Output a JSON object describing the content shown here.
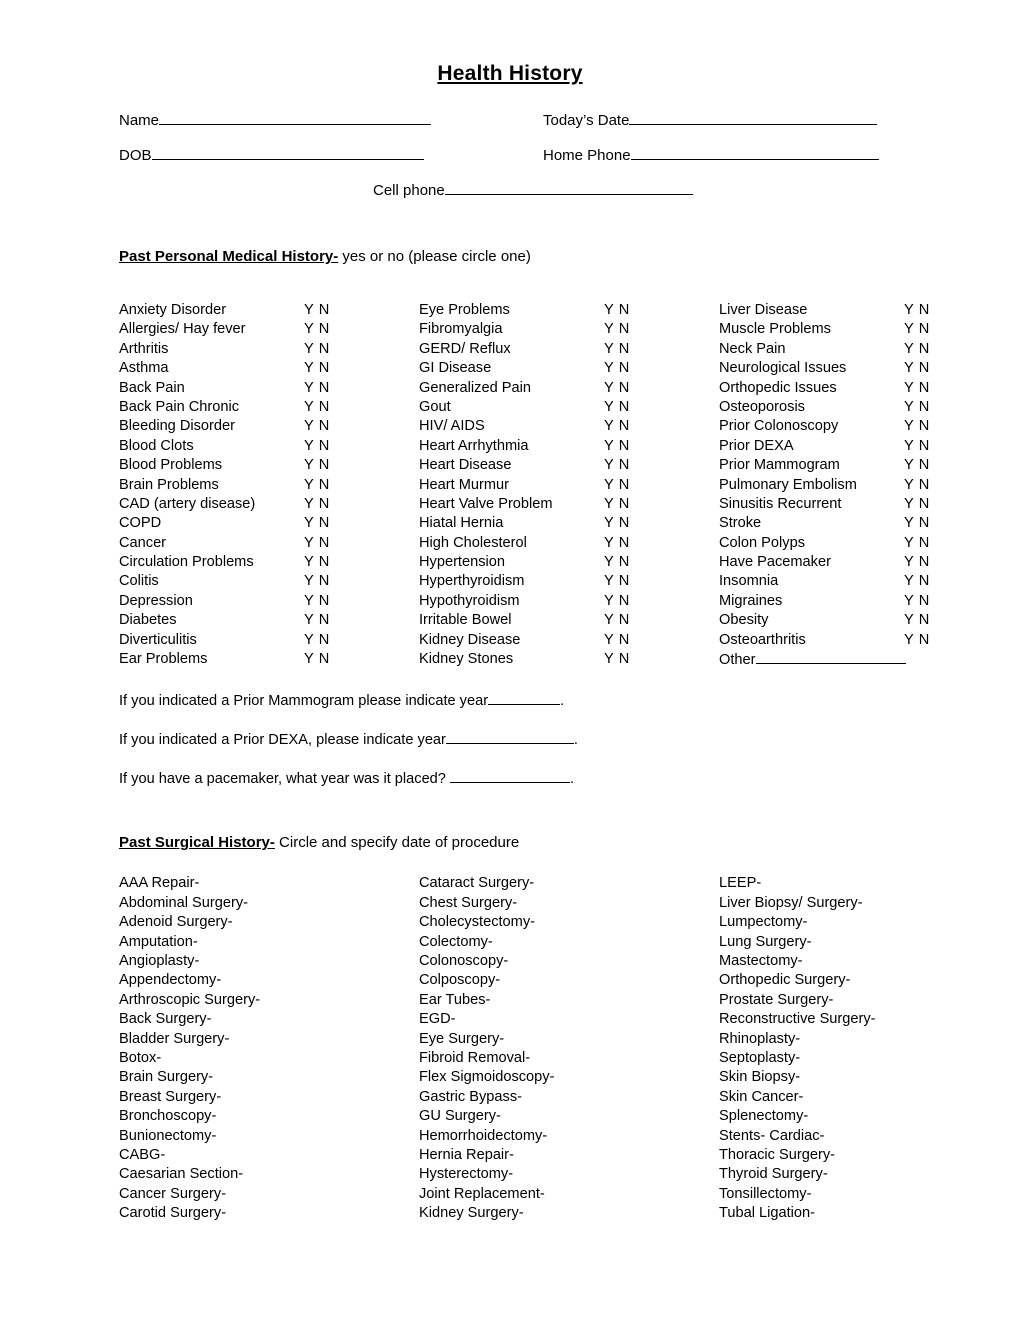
{
  "document": {
    "title": "Health History"
  },
  "patient_fields": {
    "name_label": "Name",
    "dob_label": "DOB",
    "todays_date_label": "Today’s Date",
    "home_phone_label": "Home Phone",
    "cell_phone_label": "Cell phone",
    "name_value": "",
    "dob_value": "",
    "todays_date_value": "",
    "home_phone_value": "",
    "cell_phone_value": ""
  },
  "medical_history": {
    "heading_strong": "Past Personal Medical History-",
    "heading_rest": " yes or no (please circle one)",
    "yes_no_label": "Y N",
    "columns": [
      [
        "Anxiety Disorder",
        "Allergies/ Hay fever",
        "Arthritis",
        "Asthma",
        "Back Pain",
        "Back Pain Chronic",
        "Bleeding Disorder",
        "Blood Clots",
        "Blood Problems",
        "Brain Problems",
        "CAD (artery disease)",
        "COPD",
        "Cancer",
        "Circulation Problems",
        "Colitis",
        "Depression",
        "Diabetes",
        "Diverticulitis",
        "Ear Problems"
      ],
      [
        "Eye Problems",
        "Fibromyalgia",
        "GERD/ Reflux",
        "GI Disease",
        "Generalized Pain",
        "Gout",
        "HIV/ AIDS",
        "Heart Arrhythmia",
        "Heart Disease",
        "Heart Murmur",
        "Heart Valve Problem",
        "Hiatal Hernia",
        "High Cholesterol",
        "Hypertension",
        "Hyperthyroidism",
        "Hypothyroidism",
        "Irritable Bowel",
        "Kidney Disease",
        "Kidney Stones"
      ],
      [
        "Liver Disease",
        "Muscle Problems",
        "Neck Pain",
        "Neurological Issues",
        "Orthopedic Issues",
        "Osteoporosis",
        "Prior Colonoscopy",
        "Prior DEXA",
        "Prior Mammogram",
        "Pulmonary Embolism",
        "Sinusitis Recurrent",
        "Stroke",
        "Colon Polyps",
        "Have Pacemaker",
        "Insomnia",
        "Migraines",
        "Obesity",
        "Osteoarthritis"
      ]
    ],
    "other_label": "Other",
    "followups": [
      {
        "before": "If you indicated a Prior Mammogram please indicate year",
        "after": ".",
        "value": ""
      },
      {
        "before": "If you indicated a Prior DEXA, please indicate year",
        "after": ".",
        "value": ""
      },
      {
        "before": "If you have a pacemaker, what year was it placed? ",
        "after": ".",
        "value": ""
      }
    ]
  },
  "surgical_history": {
    "heading_strong": "Past Surgical History-",
    "heading_rest": " Circle and specify date of procedure",
    "columns": [
      [
        "AAA Repair-",
        "Abdominal Surgery-",
        "Adenoid Surgery-",
        "Amputation-",
        "Angioplasty-",
        "Appendectomy-",
        "Arthroscopic Surgery-",
        "Back Surgery-",
        "Bladder Surgery-",
        "Botox-",
        "Brain Surgery-",
        "Breast Surgery-",
        "Bronchoscopy-",
        "Bunionectomy-",
        "CABG-",
        "Caesarian Section-",
        "Cancer Surgery-",
        "Carotid Surgery-"
      ],
      [
        "Cataract Surgery-",
        "Chest Surgery-",
        "Cholecystectomy-",
        "Colectomy-",
        "Colonoscopy-",
        "Colposcopy-",
        "Ear Tubes-",
        "EGD-",
        "Eye Surgery-",
        "Fibroid Removal-",
        "Flex Sigmoidoscopy-",
        "Gastric Bypass-",
        "GU Surgery-",
        "Hemorrhoidectomy-",
        "Hernia Repair-",
        "Hysterectomy-",
        "Joint Replacement-",
        "Kidney Surgery-"
      ],
      [
        "LEEP-",
        "Liver Biopsy/ Surgery-",
        "Lumpectomy-",
        "Lung Surgery-",
        "Mastectomy-",
        "Orthopedic Surgery-",
        "Prostate Surgery-",
        "Reconstructive Surgery-",
        "Rhinoplasty-",
        "Septoplasty-",
        "Skin Biopsy-",
        "Skin Cancer-",
        "Splenectomy-",
        "Stents- Cardiac-",
        "Thoracic Surgery-",
        "Thyroid Surgery-",
        "Tonsillectomy-",
        "Tubal Ligation-"
      ]
    ]
  }
}
